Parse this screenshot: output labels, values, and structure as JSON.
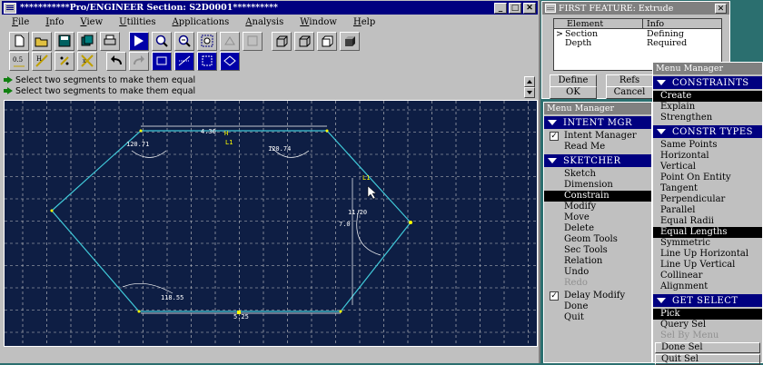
{
  "main_window": {
    "title": "***********Pro/ENGINEER Section: S2D0001**********",
    "menus": [
      "File",
      "Info",
      "View",
      "Utilities",
      "Applications",
      "Analysis",
      "Window",
      "Help"
    ],
    "messages": [
      "Select two segments to make them equal",
      "Select two segments to make them equal"
    ]
  },
  "sketch": {
    "dims": {
      "top_len": "4.36",
      "angle_tl": "120.71",
      "angle_tr": "120.74",
      "right_len": "11.20",
      "right_len2": "7.0",
      "angle_bl": "118.55",
      "bottom_len": "5.25"
    },
    "constraint_labels": {
      "top": "L1",
      "right": "L1",
      "top_h": "H"
    }
  },
  "feature_window": {
    "title": "FIRST FEATURE: Extrude",
    "columns": [
      "Element",
      "Info"
    ],
    "rows": [
      {
        "marker": ">",
        "element": "Section",
        "info": "Defining"
      },
      {
        "marker": "",
        "element": "Depth",
        "info": "Required"
      }
    ],
    "buttons": {
      "define": "Define",
      "refs": "Refs",
      "ok": "OK",
      "cancel": "Cancel"
    }
  },
  "menu_left": {
    "title": "Menu Manager",
    "intent_header": "INTENT MGR",
    "intent_manager": "Intent Manager",
    "intent_checked": true,
    "read_me": "Read Me",
    "sketcher_header": "SKETCHER",
    "items": [
      "Sketch",
      "Dimension",
      "Constrain",
      "Modify",
      "Move",
      "Delete",
      "Geom Tools",
      "Sec Tools",
      "Relation",
      "Undo",
      "Redo"
    ],
    "selected": "Constrain",
    "disabled": "Redo",
    "delay_modify": "Delay Modify",
    "delay_checked": true,
    "done": "Done",
    "quit": "Quit"
  },
  "menu_right": {
    "title": "Menu Manager",
    "constraints_header": "CONSTRAINTS",
    "constraints": [
      "Create",
      "Explain",
      "Strengthen"
    ],
    "constraints_selected": "Create",
    "types_header": "CONSTR TYPES",
    "types": [
      "Same Points",
      "Horizontal",
      "Vertical",
      "Point On Entity",
      "Tangent",
      "Perpendicular",
      "Parallel",
      "Equal Radii",
      "Equal Lengths",
      "Symmetric",
      "Line Up Horizontal",
      "Line Up Vertical",
      "Collinear",
      "Alignment"
    ],
    "types_selected": "Equal Lengths",
    "get_select_header": "GET SELECT",
    "get_select": [
      "Pick",
      "Query Sel",
      "Sel By Menu",
      "Done Sel",
      "Quit Sel"
    ],
    "get_select_selected": "Pick",
    "get_select_disabled": "Sel By Menu"
  },
  "colors": {
    "sketch_bg": "#0e1e44",
    "sketch_line": "#40c8d8",
    "grid": "#c8c8c8",
    "dim": "#ffffff",
    "highlight": "#ffff00",
    "menu_header": "#000080"
  }
}
